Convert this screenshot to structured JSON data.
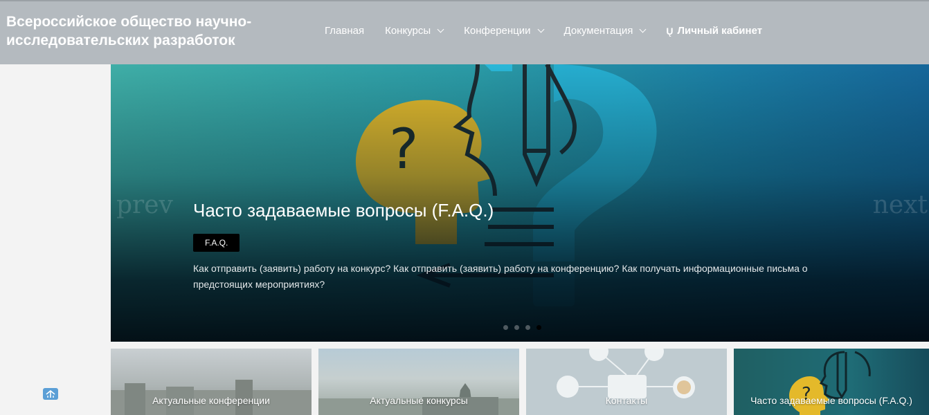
{
  "header": {
    "site_title": "Всероссийское общество научно-исследовательских разработок",
    "nav": [
      {
        "label": "Главная",
        "dropdown": false
      },
      {
        "label": "Конкурсы",
        "dropdown": true
      },
      {
        "label": "Конференции",
        "dropdown": true
      },
      {
        "label": "Документация",
        "dropdown": true
      }
    ],
    "cabinet": {
      "icon": "user-icon",
      "glyph": "Ų",
      "label": "Личный кабинет"
    }
  },
  "slider": {
    "prev_label": "prev",
    "next_label": "next",
    "title": "Часто задаваемые вопросы (F.A.Q.)",
    "tag": "F.A.Q.",
    "text": "Как отправить (заявить) работу на конкурс? Как отправить (заявить) работу на конференцию? Как получать информационные письма о предстоящих мероприятиях?",
    "dots_total": 4,
    "active_dot": 4,
    "image_icons": [
      "head-question-icon",
      "head-outline-icon",
      "pencil-icon",
      "question-mark-icon"
    ]
  },
  "tiles": [
    {
      "label": "Актуальные конференции"
    },
    {
      "label": "Актуальные конкурсы"
    },
    {
      "label": "Контакты"
    },
    {
      "label": "Часто задаваемые вопросы (F.A.Q.)"
    }
  ],
  "colors": {
    "header_bg": "#b4babf",
    "page_bg": "#f3f3f3",
    "tag_bg": "#000000",
    "accent_yellow": "#e4b92a",
    "accent_cyan": "#2ab7d8"
  }
}
